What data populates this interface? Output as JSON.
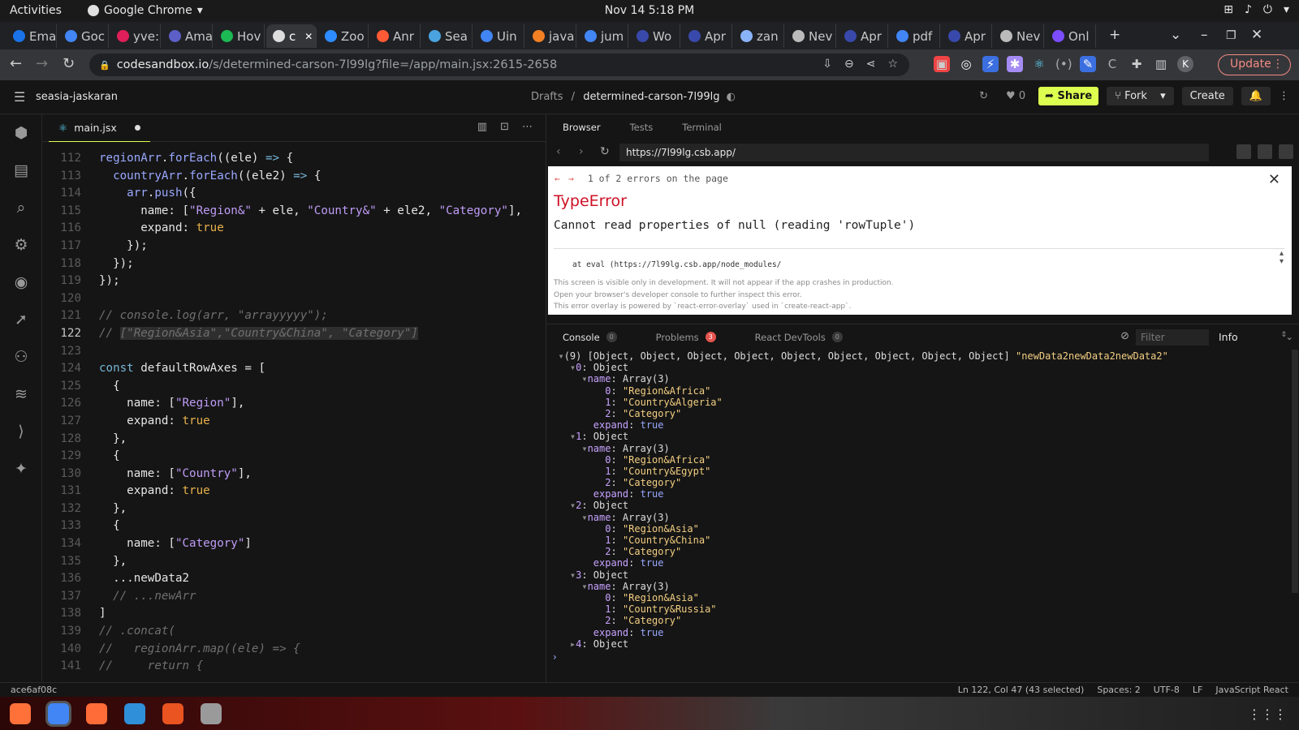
{
  "gnome": {
    "activities": "Activities",
    "app": "Google Chrome",
    "clock": "Nov 14  5:18 PM"
  },
  "tabs": [
    {
      "label": "Ema",
      "color": "#1a73e8"
    },
    {
      "label": "Goc",
      "color": "#4285f4"
    },
    {
      "label": "yve:",
      "color": "#e01e5a"
    },
    {
      "label": "Ama",
      "color": "#5b5fc7"
    },
    {
      "label": "Hov",
      "color": "#1db954"
    },
    {
      "label": "c",
      "color": "#dddddd",
      "active": true
    },
    {
      "label": "Zoo",
      "color": "#2d8cff"
    },
    {
      "label": "Anr",
      "color": "#ff5a36"
    },
    {
      "label": "Sea",
      "color": "#4aa3df"
    },
    {
      "label": "Uin",
      "color": "#4285f4"
    },
    {
      "label": "java",
      "color": "#f48024"
    },
    {
      "label": "jum",
      "color": "#4285f4"
    },
    {
      "label": "Wo",
      "color": "#3949ab"
    },
    {
      "label": "Apr",
      "color": "#3949ab"
    },
    {
      "label": "zan",
      "color": "#8ab4f8"
    },
    {
      "label": "Nev",
      "color": "#bbbbbb"
    },
    {
      "label": "Apr",
      "color": "#3949ab"
    },
    {
      "label": "pdf",
      "color": "#4285f4"
    },
    {
      "label": "Apr",
      "color": "#3949ab"
    },
    {
      "label": "Nev",
      "color": "#bbbbbb"
    },
    {
      "label": "Onl",
      "color": "#7b4dff"
    }
  ],
  "address": {
    "host": "codesandbox.io",
    "path": "/s/determined-carson-7l99lg?file=/app/main.jsx:2615-2658",
    "update": "Update",
    "profile": "K"
  },
  "csb": {
    "user": "seasia-jaskaran",
    "drafts": "Drafts",
    "sep": "/",
    "project": "determined-carson-7l99lg",
    "likes": "0",
    "share": "Share",
    "fork": "Fork",
    "create": "Create"
  },
  "editor": {
    "tab": "main.jsx",
    "current_line": 122,
    "lines": [
      {
        "n": 112,
        "html": "<span class=\"fn\">regionArr</span>.<span class=\"fn\">forEach</span>((ele) <span class=\"kw\">=&gt;</span> {"
      },
      {
        "n": 113,
        "html": "  <span class=\"fn\">countryArr</span>.<span class=\"fn\">forEach</span>((ele2) <span class=\"kw\">=&gt;</span> {"
      },
      {
        "n": 114,
        "html": "    <span class=\"fn\">arr</span>.<span class=\"fn\">push</span>({"
      },
      {
        "n": 115,
        "html": "      name: [<span class=\"str\">\"Region&amp;\"</span> + ele, <span class=\"str\">\"Country&amp;\"</span> + ele2, <span class=\"str\">\"Category\"</span>],"
      },
      {
        "n": 116,
        "html": "      expand: <span class=\"bool\">true</span>"
      },
      {
        "n": 117,
        "html": "    });"
      },
      {
        "n": 118,
        "html": "  });"
      },
      {
        "n": 119,
        "html": "});"
      },
      {
        "n": 120,
        "html": ""
      },
      {
        "n": 121,
        "html": "<span class=\"cm\">// console.log(arr, \"arrayyyyy\");</span>"
      },
      {
        "n": 122,
        "html": "<span class=\"cm\">// <span class=\"sel\">[\"Region&amp;Asia\",\"Country&amp;China\", \"Category\"]</span></span>"
      },
      {
        "n": 123,
        "html": ""
      },
      {
        "n": 124,
        "html": "<span class=\"kw\">const</span> defaultRowAxes = ["
      },
      {
        "n": 125,
        "html": "  {"
      },
      {
        "n": 126,
        "html": "    name: [<span class=\"str\">\"Region\"</span>],"
      },
      {
        "n": 127,
        "html": "    expand: <span class=\"bool\">true</span>"
      },
      {
        "n": 128,
        "html": "  },"
      },
      {
        "n": 129,
        "html": "  {"
      },
      {
        "n": 130,
        "html": "    name: [<span class=\"str\">\"Country\"</span>],"
      },
      {
        "n": 131,
        "html": "    expand: <span class=\"bool\">true</span>"
      },
      {
        "n": 132,
        "html": "  },"
      },
      {
        "n": 133,
        "html": "  {"
      },
      {
        "n": 134,
        "html": "    name: [<span class=\"str\">\"Category\"</span>]"
      },
      {
        "n": 135,
        "html": "  },"
      },
      {
        "n": 136,
        "html": "  ...newData2"
      },
      {
        "n": 137,
        "html": "  <span class=\"cm\">// ...newArr</span>"
      },
      {
        "n": 138,
        "html": "]"
      },
      {
        "n": 139,
        "html": "<span class=\"cm\">// .concat(</span>"
      },
      {
        "n": 140,
        "html": "<span class=\"cm\">//   regionArr.map((ele) =&gt; {</span>"
      },
      {
        "n": 141,
        "html": "<span class=\"cm\">//     return {</span>"
      }
    ]
  },
  "preview": {
    "tabs": [
      "Browser",
      "Tests",
      "Terminal"
    ],
    "url": "https://7l99lg.csb.app/",
    "error": {
      "count": "1 of 2 errors on the page",
      "title": "TypeError",
      "message": "Cannot read properties of null (reading 'rowTuple')",
      "stack": "at eval (https://7l99lg.csb.app/node_modules/",
      "footer": [
        "This screen is visible only in development. It will not appear if the app crashes in production.",
        "Open your browser's developer console to further inspect this error.",
        "This error overlay is powered by `react-error-overlay` used in `create-react-app`."
      ]
    },
    "console_tabs": [
      {
        "label": "Console",
        "badge": "0"
      },
      {
        "label": "Problems",
        "badge": "3"
      },
      {
        "label": "React DevTools",
        "badge": "0"
      }
    ],
    "filter_placeholder": "Filter",
    "level": "Info",
    "console_lines": [
      "<span class=\"ct\">  ▾</span>(9) [Object, Object, Object, Object, Object, Object, Object, Object, Object] <span class=\"cs\">\"newData2newData2newData2\"</span>",
      "<span class=\"ct\">    ▾</span><span class=\"ck\">0</span>: Object",
      "<span class=\"ct\">      ▾</span><span class=\"ck\">name</span>: Array(3)",
      "          <span class=\"ck\">0</span>: <span class=\"cs\">\"Region&amp;Africa\"</span>",
      "          <span class=\"ck\">1</span>: <span class=\"cs\">\"Country&amp;Algeria\"</span>",
      "          <span class=\"ck\">2</span>: <span class=\"cs\">\"Category\"</span>",
      "        <span class=\"ck\">expand</span>: <span class=\"cv\">true</span>",
      "<span class=\"ct\">    ▾</span><span class=\"ck\">1</span>: Object",
      "<span class=\"ct\">      ▾</span><span class=\"ck\">name</span>: Array(3)",
      "          <span class=\"ck\">0</span>: <span class=\"cs\">\"Region&amp;Africa\"</span>",
      "          <span class=\"ck\">1</span>: <span class=\"cs\">\"Country&amp;Egypt\"</span>",
      "          <span class=\"ck\">2</span>: <span class=\"cs\">\"Category\"</span>",
      "        <span class=\"ck\">expand</span>: <span class=\"cv\">true</span>",
      "<span class=\"ct\">    ▾</span><span class=\"ck\">2</span>: Object",
      "<span class=\"ct\">      ▾</span><span class=\"ck\">name</span>: Array(3)",
      "          <span class=\"ck\">0</span>: <span class=\"cs\">\"Region&amp;Asia\"</span>",
      "          <span class=\"ck\">1</span>: <span class=\"cs\">\"Country&amp;China\"</span>",
      "          <span class=\"ck\">2</span>: <span class=\"cs\">\"Category\"</span>",
      "        <span class=\"ck\">expand</span>: <span class=\"cv\">true</span>",
      "<span class=\"ct\">    ▾</span><span class=\"ck\">3</span>: Object",
      "<span class=\"ct\">      ▾</span><span class=\"ck\">name</span>: Array(3)",
      "          <span class=\"ck\">0</span>: <span class=\"cs\">\"Region&amp;Asia\"</span>",
      "          <span class=\"ck\">1</span>: <span class=\"cs\">\"Country&amp;Russia\"</span>",
      "          <span class=\"ck\">2</span>: <span class=\"cs\">\"Category\"</span>",
      "        <span class=\"ck\">expand</span>: <span class=\"cv\">true</span>",
      "<span class=\"ct\">    ▸</span><span class=\"ck\">4</span>: Object"
    ]
  },
  "status": {
    "commit": "ace6af08c",
    "position": "Ln 122, Col 47 (43 selected)",
    "spaces": "Spaces: 2",
    "encoding": "UTF-8",
    "eol": "LF",
    "language": "JavaScript React"
  },
  "taskbar": [
    {
      "name": "firefox-icon",
      "color": "#ff7139"
    },
    {
      "name": "chrome-icon",
      "color": "#4285f4"
    },
    {
      "name": "postman-icon",
      "color": "#ff6c37"
    },
    {
      "name": "vscode-icon",
      "color": "#2f8fd8"
    },
    {
      "name": "ubuntu-software-icon",
      "color": "#e95420"
    },
    {
      "name": "files-icon",
      "color": "#9a9a9a"
    }
  ]
}
